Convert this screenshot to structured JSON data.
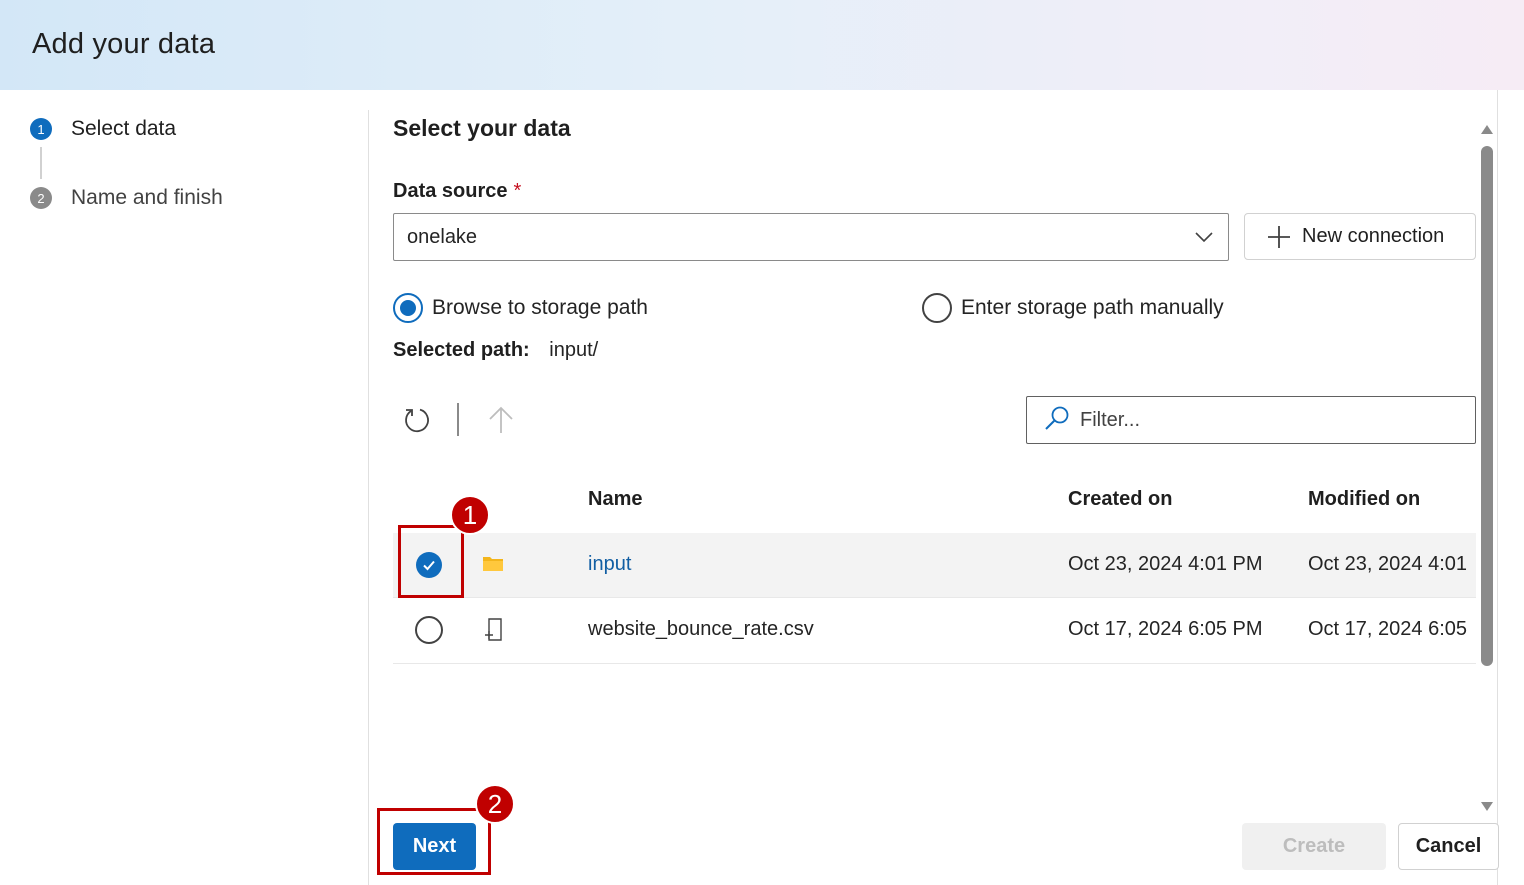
{
  "dialog": {
    "title": "Add your data"
  },
  "steps": [
    {
      "number": "1",
      "label": "Select data"
    },
    {
      "number": "2",
      "label": "Name and finish"
    }
  ],
  "main": {
    "section_title": "Select your data",
    "data_source_label": "Data source",
    "required_marker": "*",
    "data_source_value": "onelake",
    "new_connection_label": "New connection",
    "radio_browse_label": "Browse to storage path",
    "radio_manual_label": "Enter storage path manually",
    "selected_option": "browse",
    "selected_path_label": "Selected path:",
    "selected_path_value": "input/",
    "filter_placeholder": "Filter..."
  },
  "table": {
    "columns": [
      "Name",
      "Created on",
      "Modified on"
    ],
    "rows": [
      {
        "name": "input",
        "type": "folder",
        "created": "Oct 23, 2024 4:01 PM",
        "modified": "Oct 23, 2024 4:01",
        "checked": true
      },
      {
        "name": "website_bounce_rate.csv",
        "type": "file",
        "created": "Oct 17, 2024 6:05 PM",
        "modified": "Oct 17, 2024 6:05",
        "checked": false
      }
    ]
  },
  "annotations": [
    {
      "number": "1"
    },
    {
      "number": "2"
    }
  ],
  "footer": {
    "next_label": "Next",
    "create_label": "Create",
    "cancel_label": "Cancel"
  },
  "colors": {
    "accent": "#0f6cbd",
    "link": "#115ea3",
    "annotation": "#c00000",
    "folder": "#f3b51b"
  }
}
